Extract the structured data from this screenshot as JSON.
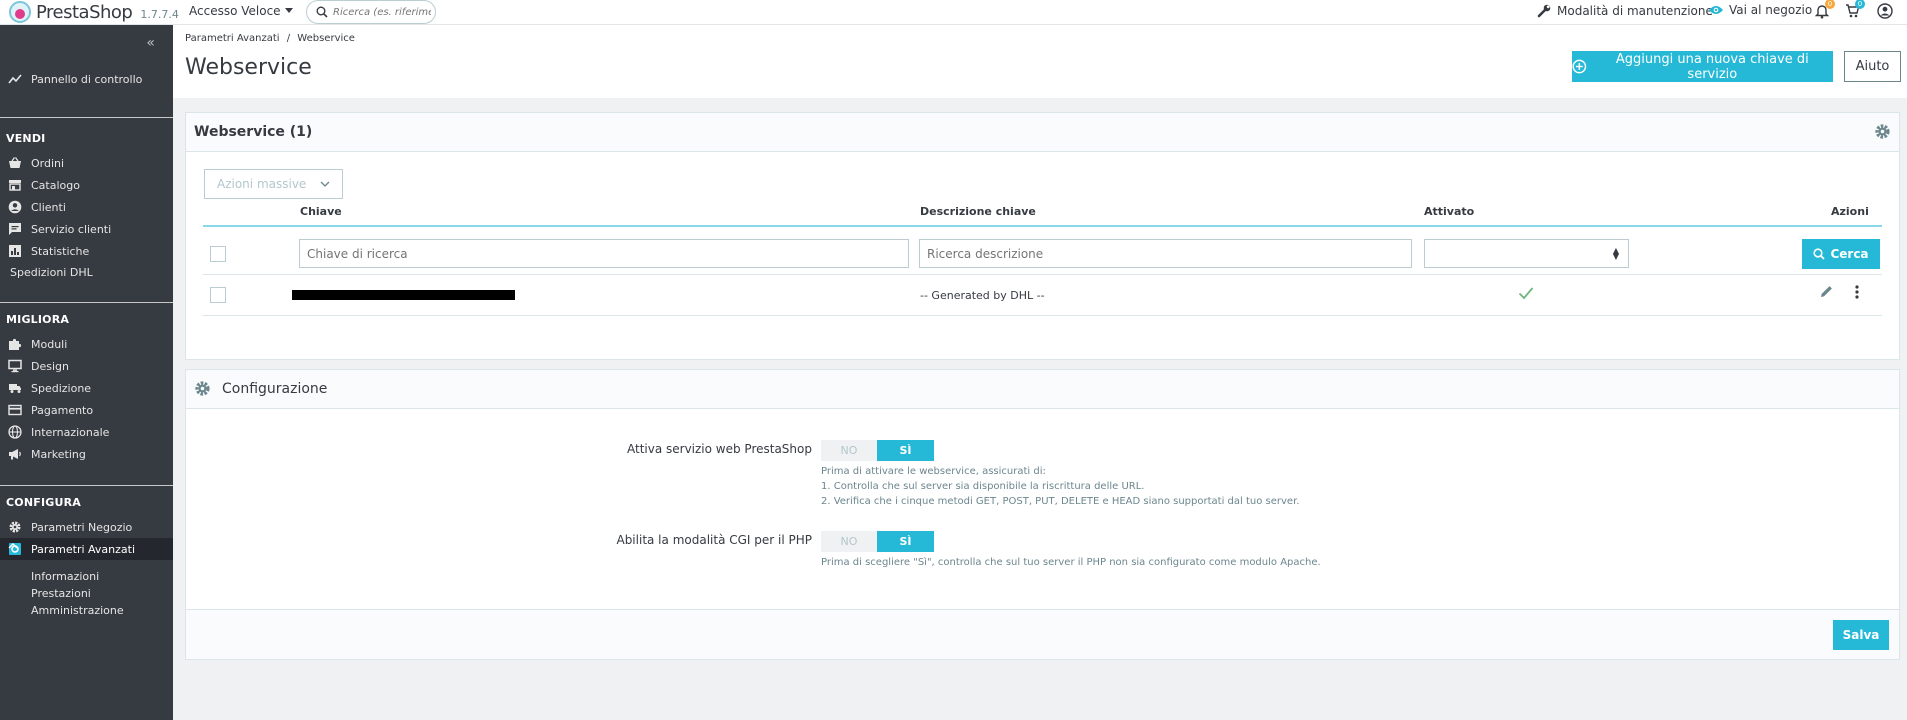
{
  "header": {
    "brand": "PrestaShop",
    "version": "1.7.7.4",
    "quick_access": "Accesso Veloce",
    "search_placeholder": "Ricerca (es. riferiment",
    "maintenance": "Modalità di manutenzione",
    "view_shop": "Vai al negozio",
    "notif_orders": "0",
    "notif_customers": "0"
  },
  "sidebar": {
    "dashboard": "Pannello di controllo",
    "sections": [
      {
        "title": "VENDI",
        "items": [
          "Ordini",
          "Catalogo",
          "Clienti",
          "Servizio clienti",
          "Statistiche"
        ]
      },
      {
        "title": "MIGLIORA",
        "items": [
          "Moduli",
          "Design",
          "Spedizione",
          "Pagamento",
          "Internazionale",
          "Marketing"
        ]
      },
      {
        "title": "CONFIGURA",
        "items": [
          "Parametri Negozio",
          "Parametri Avanzati"
        ]
      }
    ],
    "dhl": "Spedizioni DHL",
    "sub_items": [
      "Informazioni",
      "Prestazioni",
      "Amministrazione"
    ]
  },
  "breadcrumb": {
    "parent": "Parametri Avanzati",
    "sep": "/",
    "current": "Webservice"
  },
  "page_title": "Webservice",
  "toolbar": {
    "add_key": "Aggiungi una nuova chiave di servizio",
    "help": "Aiuto"
  },
  "list_panel": {
    "title": "Webservice (1)",
    "bulk_actions": "Azioni massive",
    "columns": {
      "key": "Chiave",
      "description": "Descrizione chiave",
      "enabled": "Attivato",
      "actions": "Azioni"
    },
    "filter_key_placeholder": "Chiave di ricerca",
    "filter_desc_placeholder": "Ricerca descrizione",
    "search_button": "Cerca",
    "rows": [
      {
        "description": "-- Generated by DHL --",
        "enabled": true
      }
    ]
  },
  "config_panel": {
    "title": "Configurazione",
    "field1": {
      "label": "Attiva servizio web PrestaShop",
      "no": "NO",
      "yes": "SÌ",
      "help_line1": "Prima di attivare le webservice, assicurati di:",
      "help_line2": "1. Controlla che sul server sia disponibile la riscrittura delle URL.",
      "help_line3": "2. Verifica che i cinque metodi GET, POST, PUT, DELETE e HEAD siano supportati dal tuo server."
    },
    "field2": {
      "label": "Abilita la modalità CGI per il PHP",
      "no": "NO",
      "yes": "SÌ",
      "help_line1": "Prima di scegliere \"Sì\", controlla che sul tuo server il PHP non sia configurato come modulo Apache."
    },
    "save": "Salva"
  },
  "colors": {
    "accent": "#25b9d7",
    "sidebar": "#363a41",
    "text": "#363a41",
    "success": "#70b580"
  }
}
